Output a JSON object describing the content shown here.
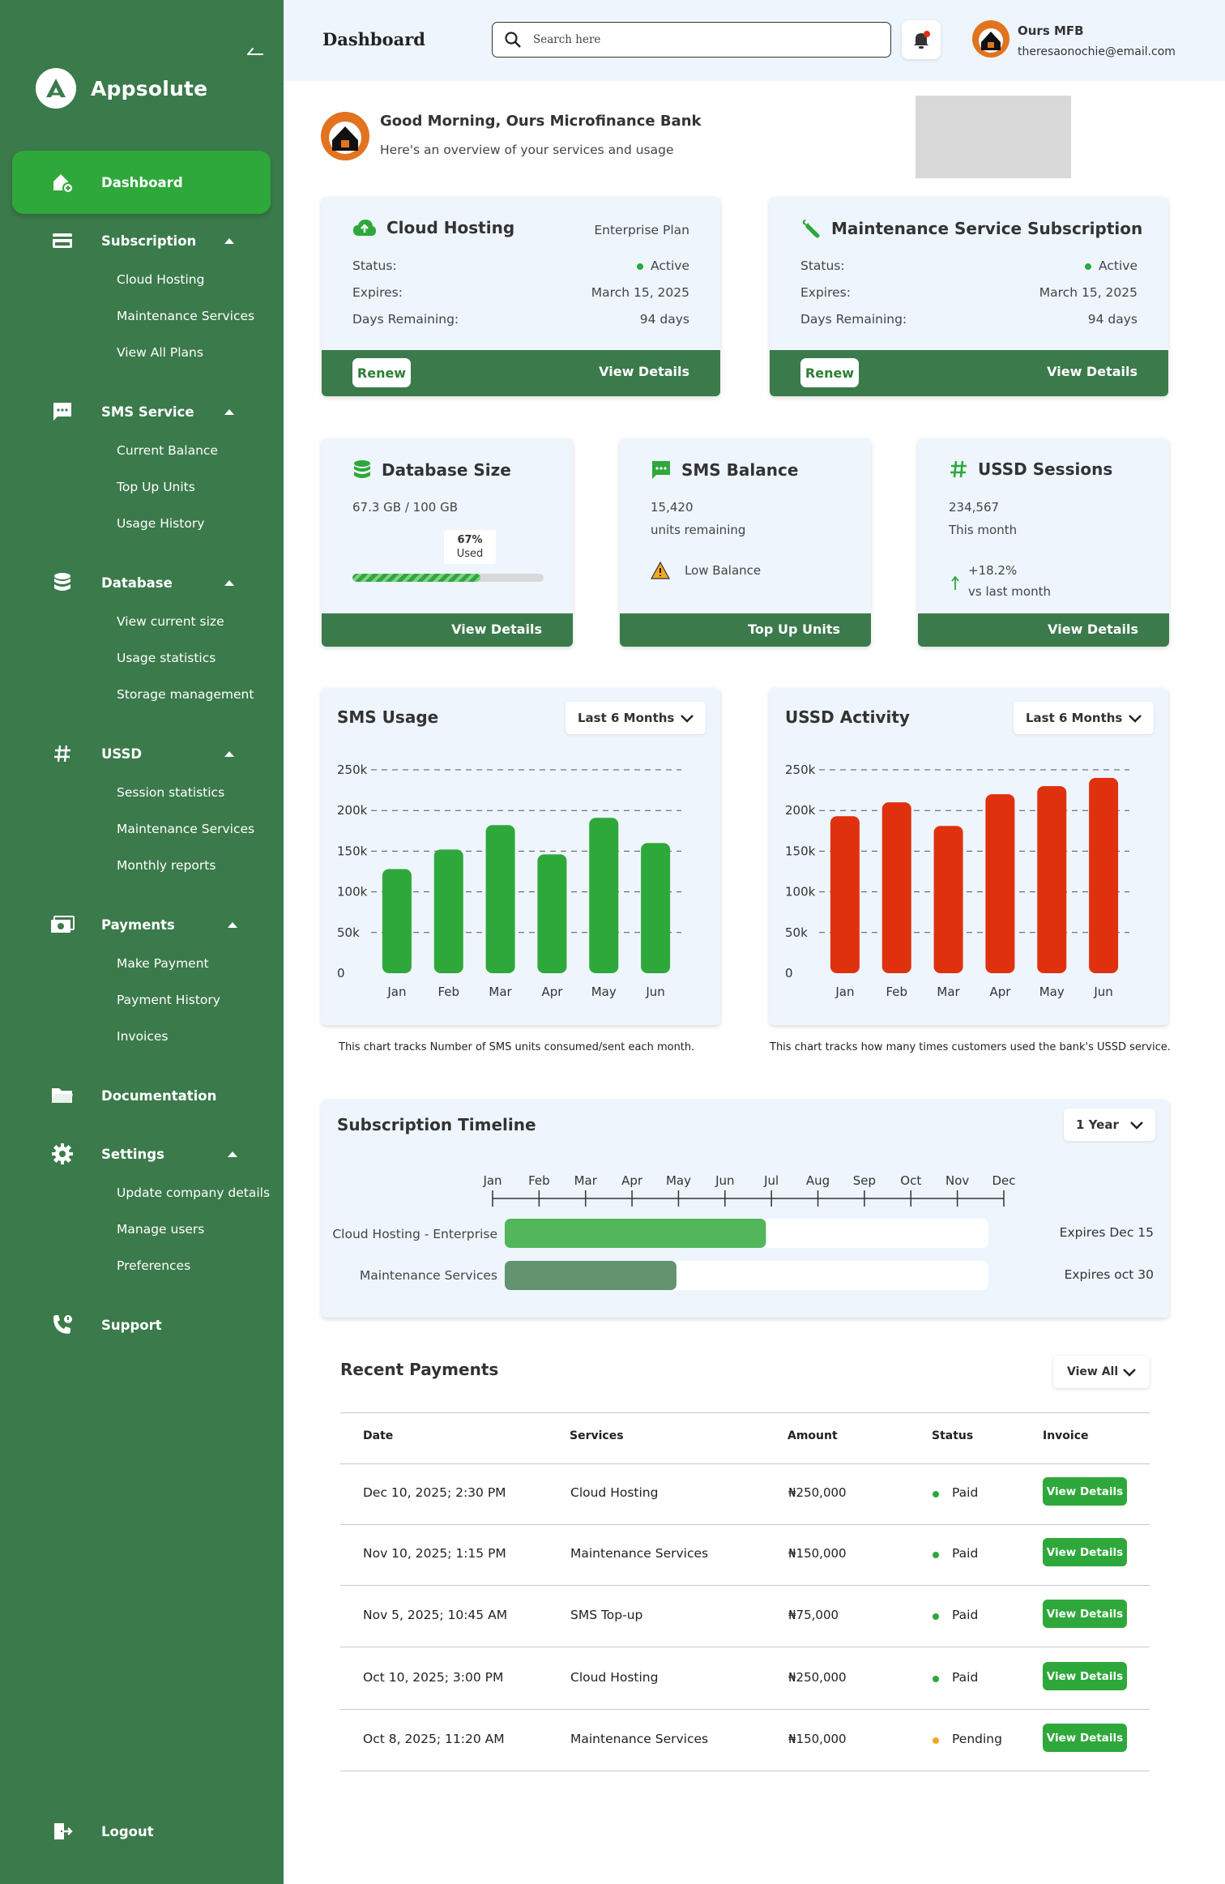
{
  "app": {
    "name": "Appsolute"
  },
  "sidebar": {
    "items": [
      {
        "label": "Dashboard",
        "icon": "home-icon",
        "active": true,
        "children": []
      },
      {
        "label": "Subscription",
        "icon": "card-icon",
        "children": [
          "Cloud Hosting",
          "Maintenance Services",
          "View All Plans"
        ]
      },
      {
        "label": "SMS Service",
        "icon": "chat-icon",
        "children": [
          "Current Balance",
          "Top Up Units",
          "Usage History"
        ]
      },
      {
        "label": "Database",
        "icon": "database-icon",
        "children": [
          "View current size",
          "Usage statistics",
          "Storage management"
        ]
      },
      {
        "label": "USSD",
        "icon": "hash-icon",
        "children": [
          "Session statistics",
          "Maintenance Services",
          "Monthly reports"
        ]
      },
      {
        "label": "Payments",
        "icon": "money-icon",
        "children": [
          "Make Payment",
          "Payment History",
          "Invoices"
        ]
      },
      {
        "label": "Documentation",
        "icon": "folder-icon",
        "children": []
      },
      {
        "label": "Settings",
        "icon": "gear-icon",
        "children": [
          "Update company details",
          "Manage users",
          "Preferences"
        ]
      },
      {
        "label": "Support",
        "icon": "phone-icon",
        "children": []
      }
    ],
    "logout": "Logout"
  },
  "header": {
    "title": "Dashboard",
    "search_placeholder": "Search here",
    "user_name": "Ours MFB",
    "user_email": "theresaonochie@email.com"
  },
  "greeting": {
    "title": "Good Morning, Ours Microfinance Bank",
    "subtitle": "Here's an overview of your services and usage"
  },
  "subscriptions": [
    {
      "title": "Cloud Hosting",
      "plan": "Enterprise Plan",
      "icon": "cloud-upload-icon",
      "status_label": "Status:",
      "status": "Active",
      "expires_label": "Expires:",
      "expires": "March 15, 2025",
      "days_label": "Days Remaining:",
      "days": "94 days",
      "renew": "Renew",
      "details": "View Details"
    },
    {
      "title": "Maintenance Service Subscription",
      "plan": "",
      "icon": "wrench-icon",
      "status_label": "Status:",
      "status": "Active",
      "expires_label": "Expires:",
      "expires": "March 15, 2025",
      "days_label": "Days Remaining:",
      "days": "94 days",
      "renew": "Renew",
      "details": "View Details"
    }
  ],
  "stats": {
    "database": {
      "title": "Database Size",
      "value": "67.3 GB / 100 GB",
      "percent_text": "67%",
      "used_text": "Used",
      "percent": 67,
      "footer": "View Details"
    },
    "sms": {
      "title": "SMS Balance",
      "value": "15,420",
      "sub": "units remaining",
      "warning": "Low Balance",
      "footer": "Top Up Units"
    },
    "ussd": {
      "title": "USSD Sessions",
      "value": "234,567",
      "sub": "This month",
      "change": "+18.2%",
      "change_sub": "vs last month",
      "footer": "View Details"
    }
  },
  "colors": {
    "sidebar": "#3b7a4b",
    "accent": "#2ea83a",
    "sms_bar": "#2ea83a",
    "ussd_bar": "#e0310f",
    "card_bg": "#eef5fd"
  },
  "chart_data": [
    {
      "type": "bar",
      "title": "SMS Usage",
      "range": "Last 6 Months",
      "categories": [
        "Jan",
        "Feb",
        "Mar",
        "Apr",
        "May",
        "Jun"
      ],
      "values": [
        128000,
        152000,
        182000,
        146000,
        191000,
        160000
      ],
      "yticks": [
        "0",
        "50k",
        "100k",
        "150k",
        "200k",
        "250k"
      ],
      "ylim": [
        0,
        250000
      ],
      "grid": true,
      "note": "This chart tracks Number of SMS units consumed/sent each month."
    },
    {
      "type": "bar",
      "title": "USSD Activity",
      "range": "Last 6 Months",
      "categories": [
        "Jan",
        "Feb",
        "Mar",
        "Apr",
        "May",
        "Jun"
      ],
      "values": [
        193000,
        210000,
        181000,
        220000,
        230000,
        240000
      ],
      "yticks": [
        "0",
        "50k",
        "100k",
        "150k",
        "200k",
        "250k"
      ],
      "ylim": [
        0,
        250000
      ],
      "grid": true,
      "note": "This chart tracks how many times customers used the bank's USSD service."
    }
  ],
  "timeline": {
    "title": "Subscription Timeline",
    "range": "1 Year",
    "months": [
      "Jan",
      "Feb",
      "Mar",
      "Apr",
      "May",
      "Jun",
      "Jul",
      "Aug",
      "Sep",
      "Oct",
      "Nov",
      "Dec"
    ],
    "bars": [
      {
        "label": "Cloud Hosting - Enterprise",
        "progress": 0.54,
        "color": "#52b65a",
        "expiry": "Expires Dec 15"
      },
      {
        "label": "Maintenance Services",
        "progress": 0.355,
        "color": "#63936f",
        "expiry": "Expires oct 30"
      }
    ]
  },
  "payments": {
    "title": "Recent Payments",
    "view_all": "View All",
    "columns": [
      "Date",
      "Services",
      "Amount",
      "Status",
      "Invoice"
    ],
    "rows": [
      {
        "date": "Dec 10, 2025; 2:30 PM",
        "service": "Cloud Hosting",
        "amount": "₦250,000",
        "status": "Paid",
        "status_color": "#2ea83a",
        "invoice": "View Details"
      },
      {
        "date": "Nov 10, 2025; 1:15 PM",
        "service": "Maintenance Services",
        "amount": "₦150,000",
        "status": "Paid",
        "status_color": "#2ea83a",
        "invoice": "View Details"
      },
      {
        "date": "Nov 5, 2025; 10:45 AM",
        "service": "SMS Top-up",
        "amount": "₦75,000",
        "status": "Paid",
        "status_color": "#2ea83a",
        "invoice": "View Details"
      },
      {
        "date": "Oct 10, 2025; 3:00 PM",
        "service": "Cloud Hosting",
        "amount": "₦250,000",
        "status": "Paid",
        "status_color": "#2ea83a",
        "invoice": "View Details"
      },
      {
        "date": "Oct 8, 2025; 11:20 AM",
        "service": "Maintenance Services",
        "amount": "₦150,000",
        "status": "Pending",
        "status_color": "#f5a623",
        "invoice": "View Details"
      }
    ]
  }
}
